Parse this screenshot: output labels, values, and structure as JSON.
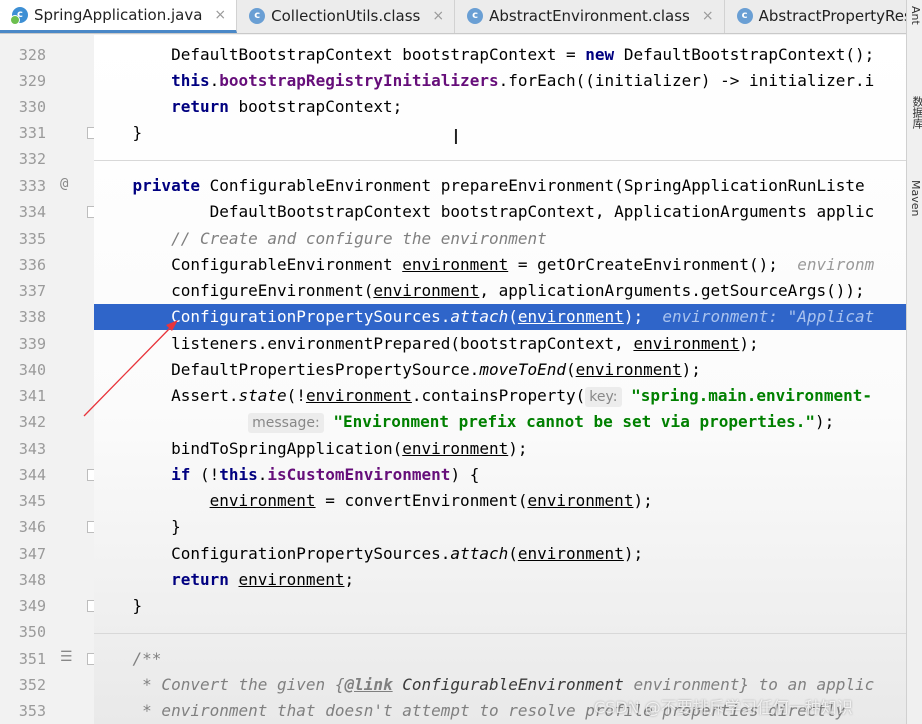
{
  "tabs": [
    {
      "label": "SpringApplication.java",
      "icon": "c",
      "active": true
    },
    {
      "label": "CollectionUtils.class",
      "icon": "c",
      "active": false
    },
    {
      "label": "AbstractEnvironment.class",
      "icon": "c",
      "active": false
    },
    {
      "label": "AbstractPropertyRes",
      "icon": "c",
      "active": false
    }
  ],
  "tab_close_glyph": "×",
  "right_strip": {
    "ant": "Ant",
    "database": "数据库",
    "maven": "Maven"
  },
  "gutter": {
    "line_numbers": [
      "328",
      "329",
      "330",
      "331",
      "332",
      "333",
      "334",
      "335",
      "336",
      "337",
      "338",
      "339",
      "340",
      "341",
      "342",
      "343",
      "344",
      "345",
      "346",
      "347",
      "348",
      "349",
      "350",
      "351",
      "352",
      "353"
    ],
    "override_marker": "@"
  },
  "code": {
    "l328_text": "DefaultBootstrapContext bootstrapContext = ",
    "l328_kw": "new",
    "l328_rest": " DefaultBootstrapContext();",
    "l329_kw": "this",
    "l329_field": "bootstrapRegistryInitializers",
    "l329_rest": ".forEach((initializer) -> initializer.i",
    "l330_kw": "return",
    "l330_rest": " bootstrapContext;",
    "l331": "}",
    "l333_kw": "private",
    "l333_rest": " ConfigurableEnvironment prepareEnvironment(SpringApplicationRunListe",
    "l334": "DefaultBootstrapContext bootstrapContext, ApplicationArguments applic",
    "l335": "// Create and configure the environment",
    "l336_a": "ConfigurableEnvironment ",
    "l336_var": "environment",
    "l336_b": " = getOrCreateEnvironment();",
    "l336_hint": "environm",
    "l337_a": "configureEnvironment(",
    "l337_var": "environment",
    "l337_b": ", applicationArguments.getSourceArgs());",
    "l338_a": "ConfigurationPropertySources.",
    "l338_method": "attach",
    "l338_b": "(",
    "l338_var": "environment",
    "l338_c": ");",
    "l338_hint": "environment: \"Applicat",
    "l339_a": "listeners.environmentPrepared(bootstrapContext, ",
    "l339_var": "environment",
    "l339_b": ");",
    "l340_a": "DefaultPropertiesPropertySource.",
    "l340_method": "moveToEnd",
    "l340_b": "(",
    "l340_var": "environment",
    "l340_c": ");",
    "l341_a": "Assert.",
    "l341_method": "state",
    "l341_b": "(!",
    "l341_var": "environment",
    "l341_c": ".containsProperty(",
    "l341_pill": "key:",
    "l341_str": "\"spring.main.environment-",
    "l342_pill": "message:",
    "l342_str": "\"Environment prefix cannot be set via properties.\"",
    "l342_end": ");",
    "l343_a": "bindToSpringApplication(",
    "l343_var": "environment",
    "l343_b": ");",
    "l344_kw1": "if",
    "l344_a": " (!",
    "l344_kw2": "this",
    "l344_b": ".",
    "l344_field": "isCustomEnvironment",
    "l344_c": ") {",
    "l345_var1": "environment",
    "l345_a": " = convertEnvironment(",
    "l345_var2": "environment",
    "l345_b": ");",
    "l346": "}",
    "l347_a": "ConfigurationPropertySources.",
    "l347_method": "attach",
    "l347_b": "(",
    "l347_var": "environment",
    "l347_c": ");",
    "l348_kw": "return",
    "l348_var": "environment",
    "l348_b": ";",
    "l349": "}",
    "l351": "/**",
    "l352_a": " * Convert the given {",
    "l352_tag": "@link",
    "l352_b": " ConfigurableEnvironment",
    "l352_c": " environment} to an applic",
    "l353": " * environment that doesn't attempt to resolve profile properties directly"
  },
  "watermark": "CSDN @不要排斥学习任何一种知识",
  "colors": {
    "selection": "#2f65c9",
    "keyword": "#000080",
    "field": "#660e7a",
    "string": "#008000",
    "comment": "#808080",
    "arrow": "#e8343b"
  }
}
